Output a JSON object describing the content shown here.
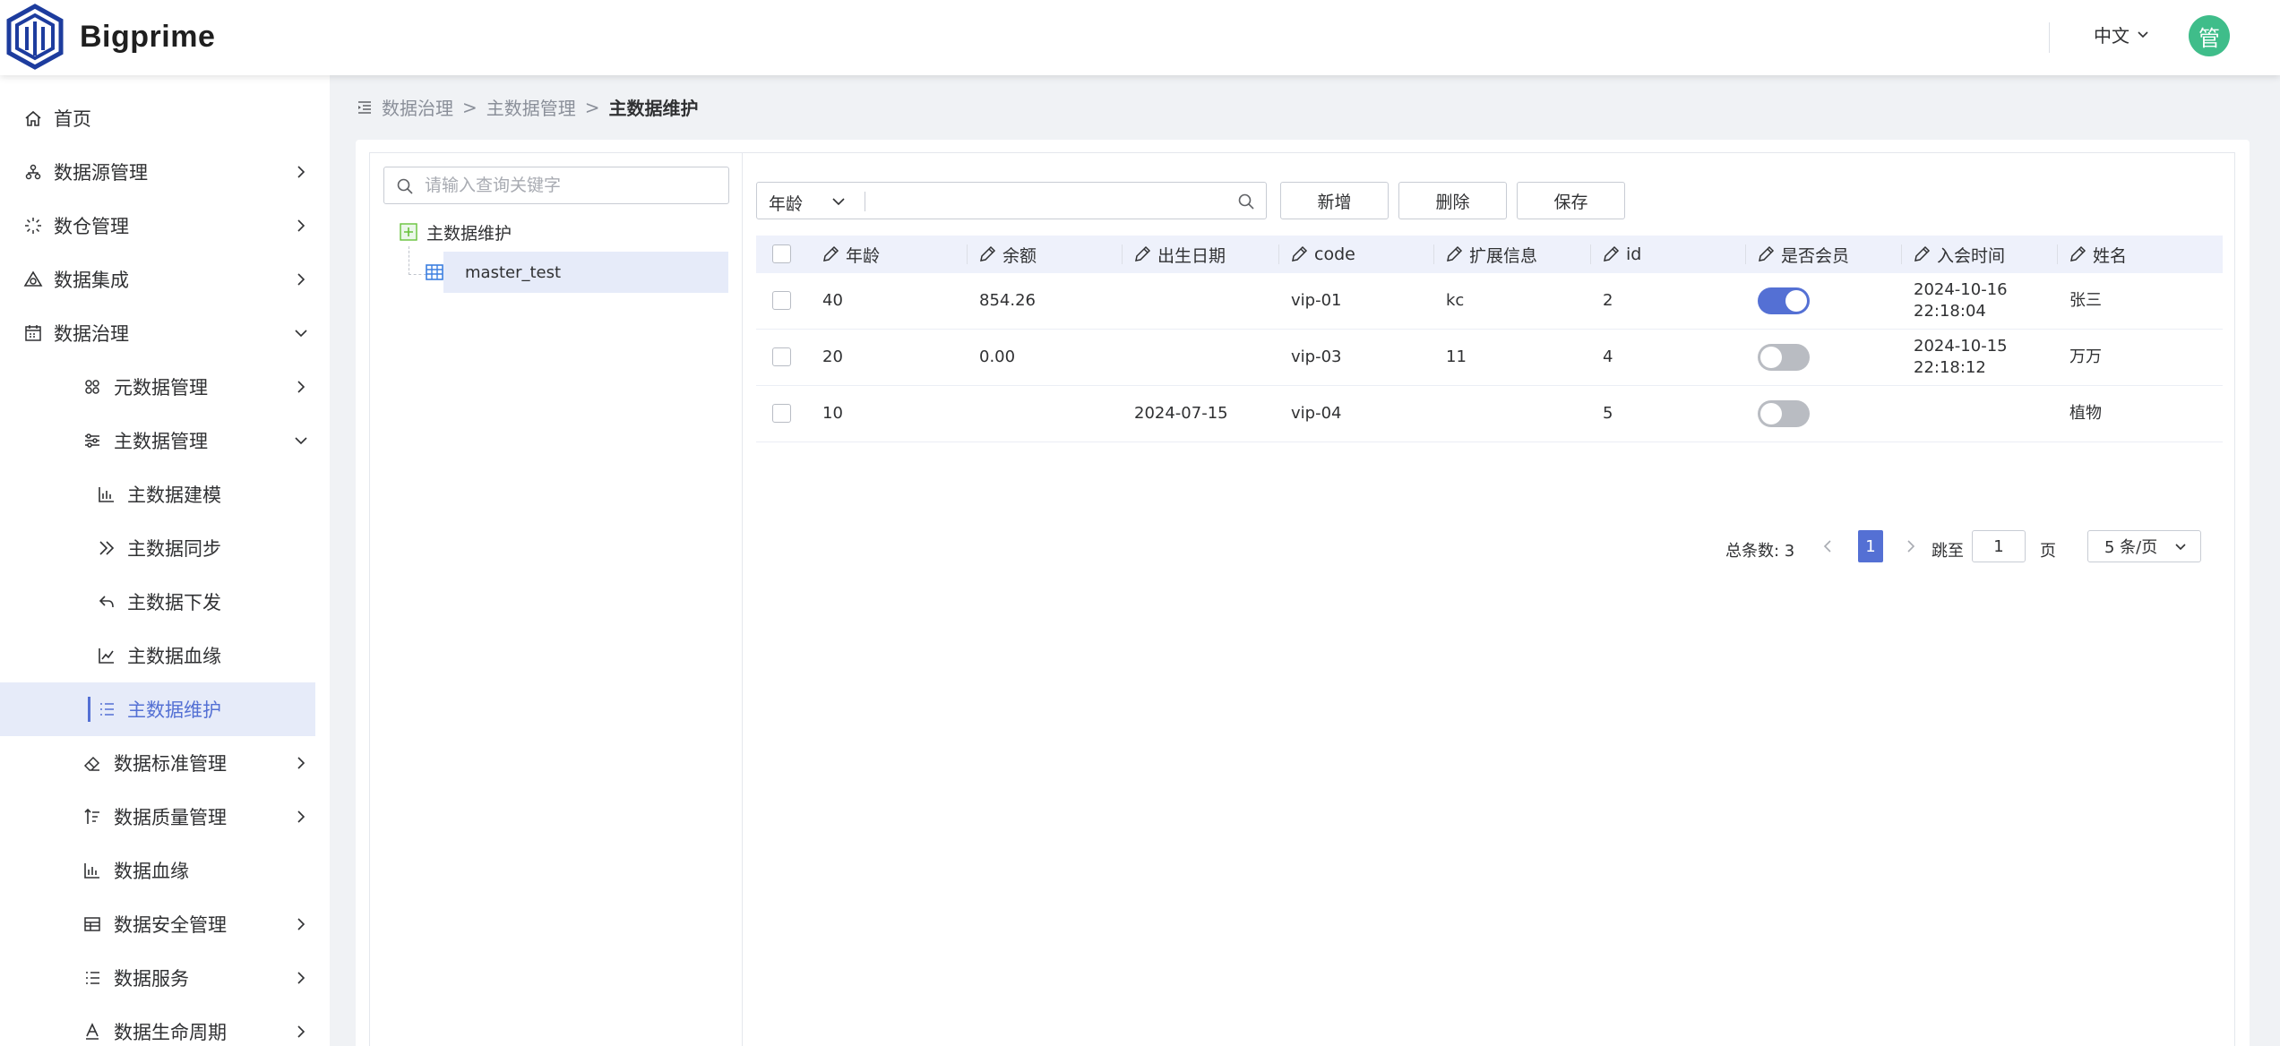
{
  "app": {
    "brand": "Bigprime",
    "language": "中文",
    "avatar_text": "管",
    "accent_color": "#5470d4",
    "avatar_color": "#3fbd8a"
  },
  "sidebar": {
    "items": [
      {
        "label": "首页",
        "icon": "home-icon",
        "has_arrow": false,
        "expanded": false
      },
      {
        "label": "数据源管理",
        "icon": "datasource-icon",
        "has_arrow": true,
        "expanded": false
      },
      {
        "label": "数仓管理",
        "icon": "warehouse-icon",
        "has_arrow": true,
        "expanded": false
      },
      {
        "label": "数据集成",
        "icon": "integration-icon",
        "has_arrow": true,
        "expanded": false
      },
      {
        "label": "数据治理",
        "icon": "calendar-icon",
        "has_arrow": true,
        "expanded": true
      },
      {
        "label": "元数据管理",
        "icon": "metadata-icon",
        "has_arrow": true,
        "expanded": false
      },
      {
        "label": "主数据管理",
        "icon": "sliders-icon",
        "has_arrow": true,
        "expanded": true
      },
      {
        "label": "主数据建模",
        "icon": "bar-chart-icon",
        "has_arrow": false
      },
      {
        "label": "主数据同步",
        "icon": "double-chevron-icon",
        "has_arrow": false
      },
      {
        "label": "主数据下发",
        "icon": "reply-icon",
        "has_arrow": false
      },
      {
        "label": "主数据血缘",
        "icon": "line-chart-icon",
        "has_arrow": false
      },
      {
        "label": "主数据维护",
        "icon": "list-icon",
        "has_arrow": false,
        "active": true
      },
      {
        "label": "数据标准管理",
        "icon": "eraser-icon",
        "has_arrow": true
      },
      {
        "label": "数据质量管理",
        "icon": "sort-icon",
        "has_arrow": true
      },
      {
        "label": "数据血缘",
        "icon": "bar-chart-icon",
        "has_arrow": false
      },
      {
        "label": "数据安全管理",
        "icon": "table-icon",
        "has_arrow": true
      },
      {
        "label": "数据服务",
        "icon": "list-icon",
        "has_arrow": true
      },
      {
        "label": "数据生命周期",
        "icon": "text-a-icon",
        "has_arrow": true
      }
    ]
  },
  "breadcrumb": {
    "items": [
      "数据治理",
      "主数据管理"
    ],
    "current": "主数据维护"
  },
  "tree": {
    "search_placeholder": "请输入查询关键字",
    "root_label": "主数据维护",
    "child_label": "master_test"
  },
  "toolbar": {
    "field_select": "年龄",
    "search_value": "",
    "add_label": "新增",
    "delete_label": "删除",
    "save_label": "保存"
  },
  "table": {
    "columns": [
      "年龄",
      "余额",
      "出生日期",
      "code",
      "扩展信息",
      "id",
      "是否会员",
      "入会时间",
      "姓名"
    ],
    "rows": [
      {
        "age": "40",
        "balance": "854.26",
        "birth": "",
        "code": "vip-01",
        "ext": "kc",
        "id": "2",
        "member": true,
        "join_date": "2024-10-16",
        "join_time": "22:18:04",
        "name": "张三"
      },
      {
        "age": "20",
        "balance": "0.00",
        "birth": "",
        "code": "vip-03",
        "ext": "11",
        "id": "4",
        "member": false,
        "join_date": "2024-10-15",
        "join_time": "22:18:12",
        "name": "万万"
      },
      {
        "age": "10",
        "balance": "",
        "birth": "2024-07-15",
        "code": "vip-04",
        "ext": "",
        "id": "5",
        "member": false,
        "join_date": "",
        "join_time": "",
        "name": "植物"
      }
    ]
  },
  "pagination": {
    "total_label": "总条数: 3",
    "current_page": "1",
    "jump_label": "跳至",
    "jump_value": "1",
    "page_unit": "页",
    "page_size": "5 条/页"
  }
}
